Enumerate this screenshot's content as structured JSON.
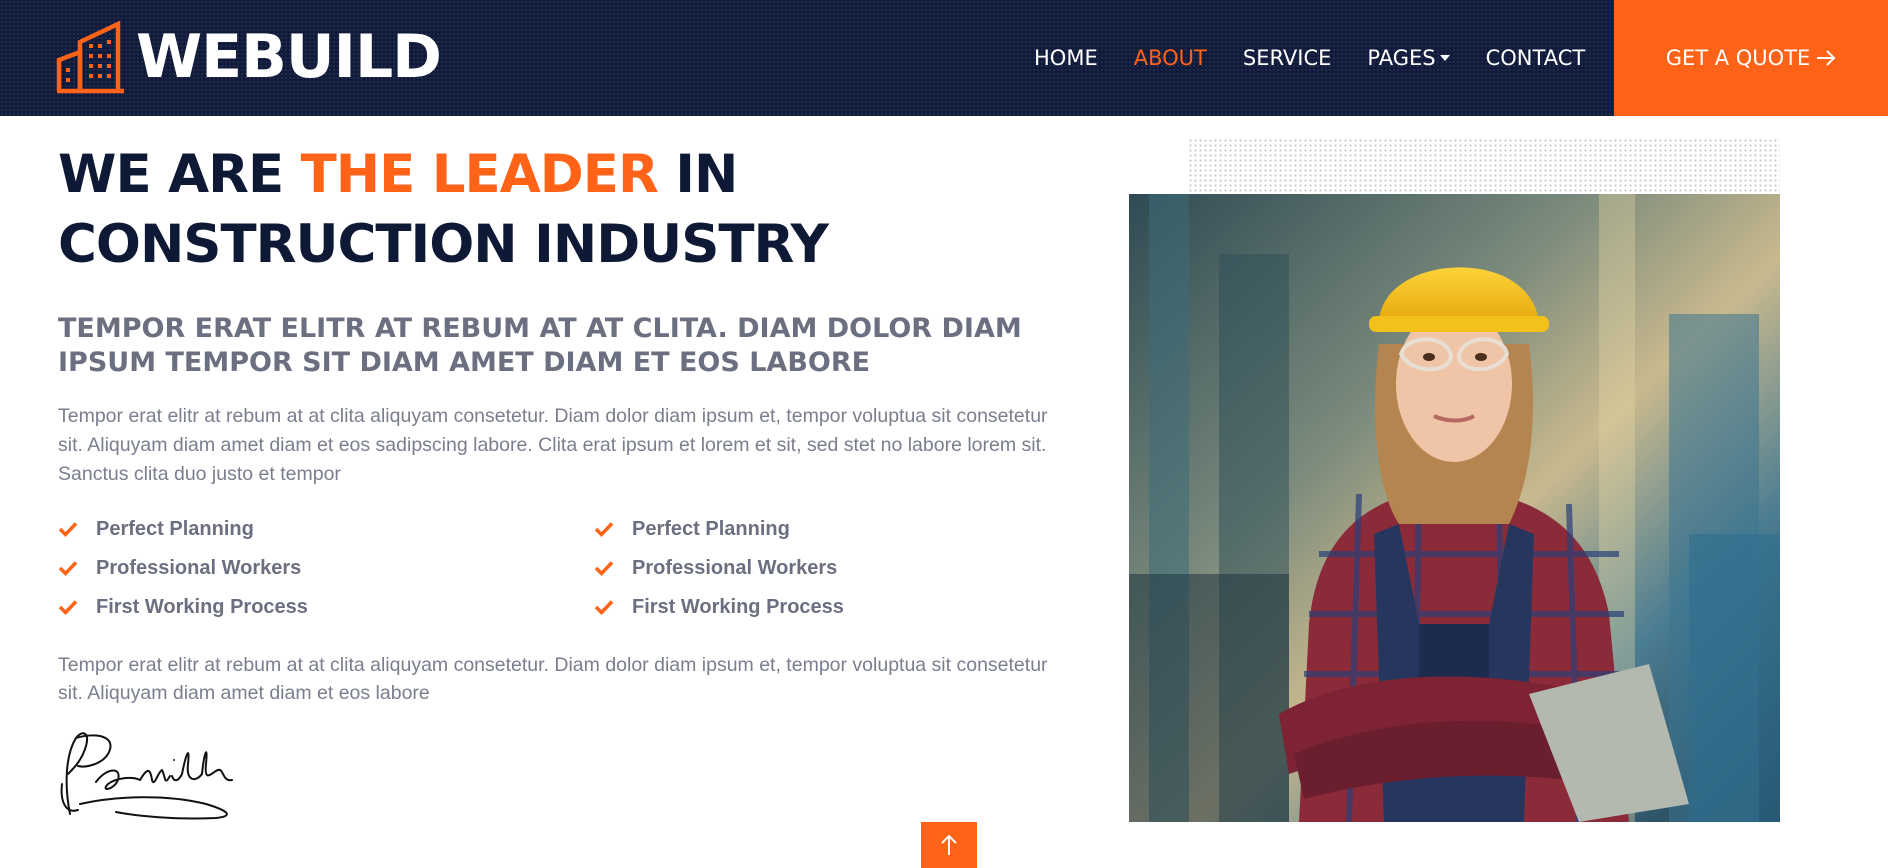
{
  "brand": {
    "name": "WEBUILD",
    "icon": "building-icon"
  },
  "nav": {
    "items": [
      {
        "label": "HOME",
        "active": false
      },
      {
        "label": "ABOUT",
        "active": true
      },
      {
        "label": "SERVICE",
        "active": false
      },
      {
        "label": "PAGES",
        "active": false,
        "dropdown": true
      },
      {
        "label": "CONTACT",
        "active": false
      }
    ],
    "cta_label": "GET A QUOTE",
    "cta_icon": "arrow-right-icon"
  },
  "about": {
    "heading_part1": "WE ARE ",
    "heading_accent": "THE LEADER",
    "heading_part2": " IN CONSTRUCTION INDUSTRY",
    "subheading": "TEMPOR ERAT ELITR AT REBUM AT AT CLITA. DIAM DOLOR DIAM IPSUM TEMPOR SIT DIAM AMET DIAM ET EOS LABORE",
    "paragraph1": "Tempor erat elitr at rebum at at clita aliquyam consetetur. Diam dolor diam ipsum et, tempor voluptua sit consetetur sit. Aliquyam diam amet diam et eos sadipscing labore. Clita erat ipsum et lorem et sit, sed stet no labore lorem sit. Sanctus clita duo justo et tempor",
    "features_left": [
      "Perfect Planning",
      "Professional Workers",
      "First Working Process"
    ],
    "features_right": [
      "Perfect Planning",
      "Professional Workers",
      "First Working Process"
    ],
    "paragraph2": "Tempor erat elitr at rebum at at clita aliquyam consetetur. Diam dolor diam ipsum et, tempor voluptua sit consetetur sit. Aliquyam diam amet diam et eos labore",
    "signature_text": "P.Smith"
  },
  "image": {
    "description_icon": "worker-photo"
  },
  "back_to_top": {
    "icon": "arrow-up-icon"
  },
  "colors": {
    "accent": "#fe6318",
    "navy": "#101a3a",
    "heading": "#0e1a35",
    "text": "#6b6f80"
  }
}
